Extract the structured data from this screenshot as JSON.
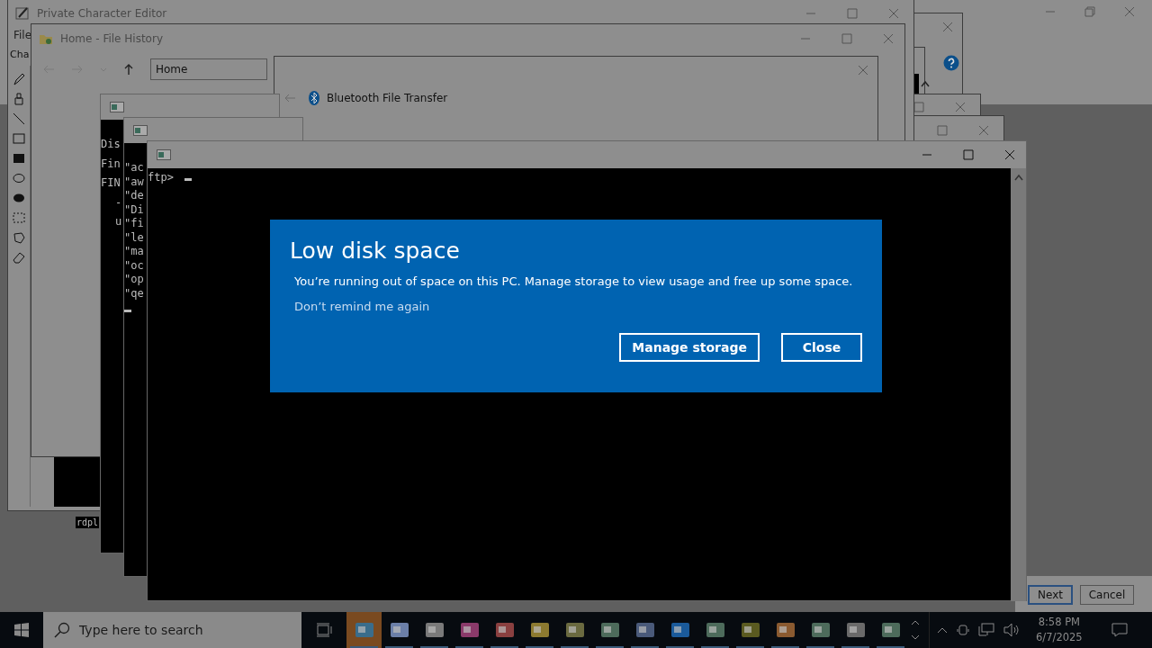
{
  "char_editor": {
    "title": "Private Character Editor",
    "menu_item": "File",
    "label": "Cha"
  },
  "file_history": {
    "title": "Home - File History",
    "address": "Home"
  },
  "bluetooth": {
    "title": "Bluetooth File Transfer"
  },
  "console_1": {
    "lines": [
      {
        "text": "Dis",
        "indent": false
      },
      {
        "text": "Fin",
        "indent": false
      },
      {
        "text": "FIN",
        "indent": false
      },
      {
        "text": "-",
        "indent": true
      },
      {
        "text": "u",
        "indent": true
      }
    ]
  },
  "console_2": {
    "lines": [
      "\"ac",
      "\"aw",
      "\"de",
      "\"Di",
      "\"fi",
      "\"le",
      "\"ma",
      "\"oc",
      "\"op",
      "\"qe"
    ]
  },
  "console_3": {
    "prompt": "ftp>"
  },
  "background_console": {
    "text": "rdpl"
  },
  "wizard": {
    "buttons": [
      {
        "label": "Next",
        "default": true
      },
      {
        "label": "Cancel",
        "default": false
      }
    ]
  },
  "dialog": {
    "title": "Low disk space",
    "message": "You’re running out of space on this PC. Manage storage to view usage and free up some space.",
    "link": "Don’t remind me again",
    "buttons": [
      "Manage storage",
      "Close"
    ]
  },
  "taskbar": {
    "search_placeholder": "Type here to search",
    "time": "8:58 PM",
    "date": "6/7/2025",
    "apps": [
      {
        "active": true
      },
      {
        "active": false
      },
      {
        "active": false
      },
      {
        "active": false
      },
      {
        "active": false
      },
      {
        "active": false
      },
      {
        "active": false
      },
      {
        "active": false
      },
      {
        "active": false
      },
      {
        "active": false
      },
      {
        "active": false
      },
      {
        "active": false
      },
      {
        "active": false
      },
      {
        "active": false
      },
      {
        "active": false
      },
      {
        "active": false
      }
    ]
  }
}
